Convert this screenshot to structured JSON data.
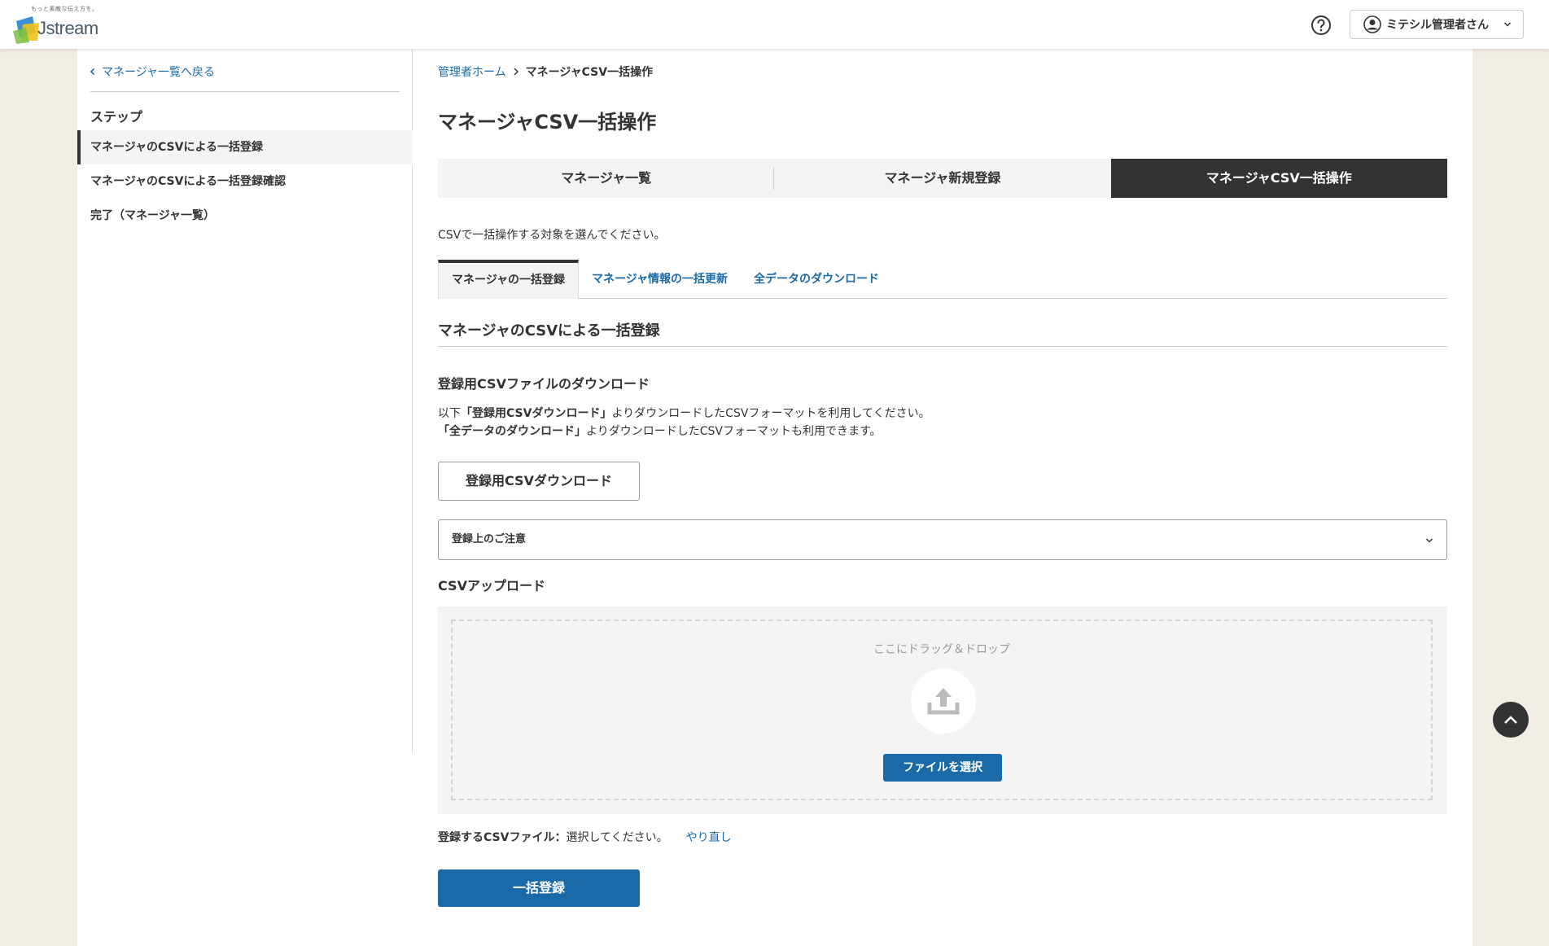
{
  "header": {
    "logo_tagline": "もっと素敵な伝え方を。",
    "logo_text": "Jstream",
    "user_name": "ミテシル管理者さん"
  },
  "sidebar": {
    "back_label": "マネージャ一覧へ戻る",
    "steps_title": "ステップ",
    "steps": [
      {
        "label": "マネージャのCSVによる一括登録"
      },
      {
        "label": "マネージャのCSVによる一括登録確認"
      },
      {
        "label": "完了（マネージャ一覧）"
      }
    ]
  },
  "breadcrumb": {
    "home": "管理者ホーム",
    "current": "マネージャCSV一括操作"
  },
  "page_title": "マネージャCSV一括操作",
  "main_tabs": [
    {
      "label": "マネージャ一覧"
    },
    {
      "label": "マネージャ新規登録"
    },
    {
      "label": "マネージャCSV一括操作"
    }
  ],
  "description": "CSVで一括操作する対象を選んでください。",
  "sub_tabs": [
    {
      "label": "マネージャの一括登録"
    },
    {
      "label": "マネージャ情報の一括更新"
    },
    {
      "label": "全データのダウンロード"
    }
  ],
  "section": {
    "title": "マネージャのCSVによる一括登録",
    "download_heading": "登録用CSVファイルのダウンロード",
    "para1_prefix": "以下",
    "para1_bold": "「登録用CSVダウンロード」",
    "para1_suffix": "よりダウンロードしたCSVフォーマットを利用してください。",
    "para2_bold": "「全データのダウンロード」",
    "para2_suffix": "よりダウンロードしたCSVフォーマットも利用できます。",
    "download_button": "登録用CSVダウンロード",
    "notice_label": "登録上のご注意",
    "upload_heading": "CSVアップロード",
    "drop_text": "ここにドラッグ＆ドロップ",
    "file_select_button": "ファイルを選択",
    "file_label": "登録するCSVファイル：",
    "file_value": "選択してください。",
    "retry_label": "やり直し",
    "submit_button": "一括登録"
  },
  "colors": {
    "accent": "#1a6aa8",
    "dark": "#333333",
    "page_bg": "#f2ede4"
  }
}
